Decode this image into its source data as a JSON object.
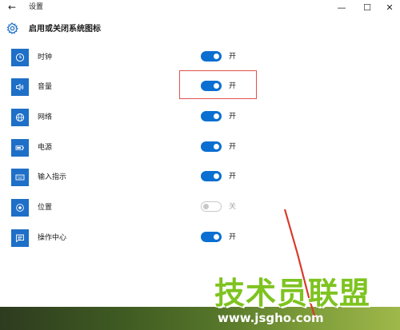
{
  "window": {
    "title": "设置",
    "back_icon": "←",
    "minimize_icon": "—",
    "maximize_icon": "☐",
    "close_icon": "✕"
  },
  "header": {
    "title": "启用或关闭系统图标",
    "icon": "gear-icon"
  },
  "items": [
    {
      "label": "时钟",
      "icon": "clock-icon",
      "state": "on",
      "state_label": "开"
    },
    {
      "label": "音量",
      "icon": "volume-icon",
      "state": "on",
      "state_label": "开"
    },
    {
      "label": "网络",
      "icon": "network-icon",
      "state": "on",
      "state_label": "开"
    },
    {
      "label": "电源",
      "icon": "battery-icon",
      "state": "on",
      "state_label": "开"
    },
    {
      "label": "输入指示",
      "icon": "keyboard-icon",
      "state": "on",
      "state_label": "开"
    },
    {
      "label": "位置",
      "icon": "location-icon",
      "state": "off",
      "state_label": "关"
    },
    {
      "label": "操作中心",
      "icon": "action-center-icon",
      "state": "on",
      "state_label": "开"
    }
  ],
  "watermark": {
    "title": "技术员联盟",
    "url": "www.jsgho.com"
  },
  "colors": {
    "accent": "#0a6fd1",
    "tile": "#1e6fc7",
    "highlight": "#e0524f",
    "toggle_off": "#c8c8c8"
  }
}
